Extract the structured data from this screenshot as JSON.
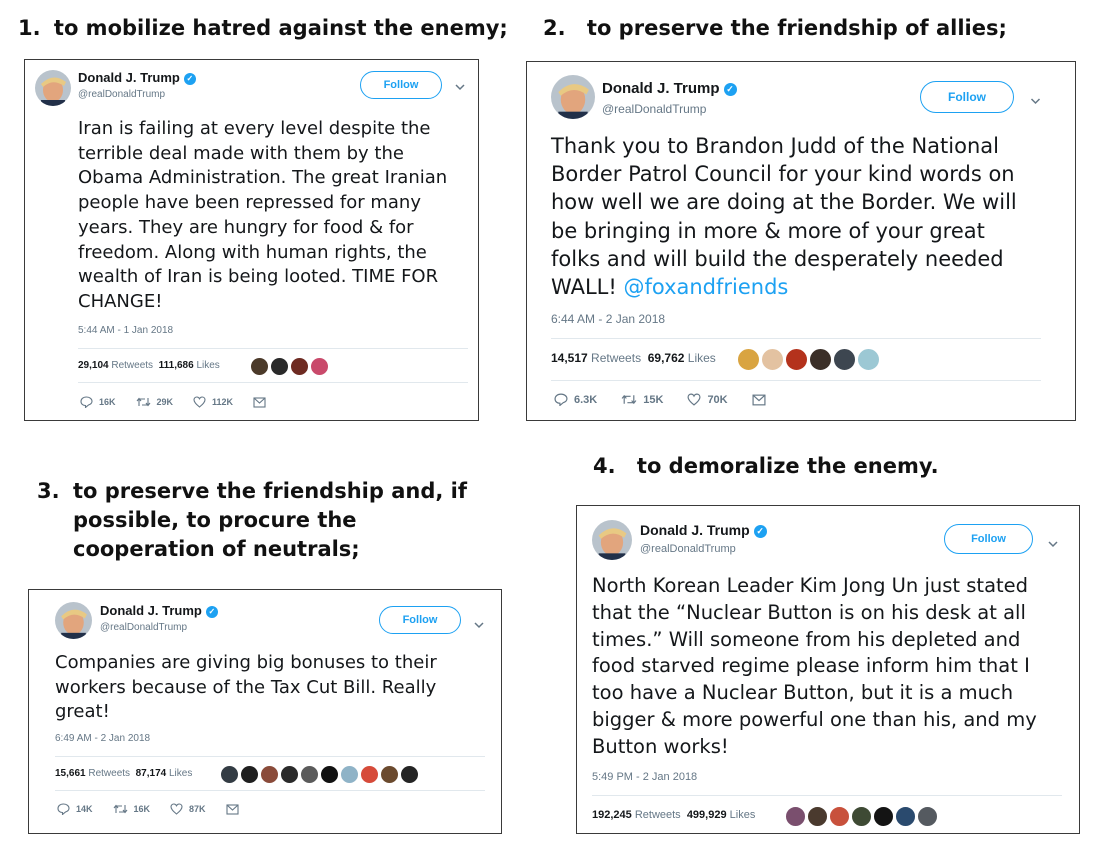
{
  "captions": [
    {
      "num": "1.",
      "text": "to mobilize hatred against the enemy;"
    },
    {
      "num": "2.",
      "text": "to preserve the friendship of allies;"
    },
    {
      "num": "3.",
      "text": "to preserve the friendship and, if possible, to procure the cooperation of neutrals;"
    },
    {
      "num": "4.",
      "text": "to demoralize the enemy."
    }
  ],
  "tweets": [
    {
      "name": "Donald J. Trump",
      "handle": "@realDonaldTrump",
      "follow_label": "Follow",
      "text": "Iran is failing at every level despite the\nterrible deal made with them by the\nObama Administration. The great Iranian\npeople have been repressed for many\nyears. They are hungry for food & for\nfreedom. Along with human rights, the\nwealth of Iran is being looted. TIME FOR\nCHANGE!",
      "link": "",
      "time": "5:44 AM - 1 Jan 2018",
      "retweets": "29,104",
      "retweets_label": "Retweets",
      "likes": "111,686",
      "likes_label": "Likes",
      "replies_count": "16K",
      "retweet_count": "29K",
      "like_count": "112K"
    },
    {
      "name": "Donald J. Trump",
      "handle": "@realDonaldTrump",
      "follow_label": "Follow",
      "text": "Thank you to Brandon Judd of the National\nBorder Patrol Council for your kind words on\nhow well we are doing at the Border. We will\nbe bringing in more & more of your great\nfolks and will build the desperately needed\nWALL! ",
      "link": "@foxandfriends",
      "time": "6:44 AM - 2 Jan 2018",
      "retweets": "14,517",
      "retweets_label": "Retweets",
      "likes": "69,762",
      "likes_label": "Likes",
      "replies_count": "6.3K",
      "retweet_count": "15K",
      "like_count": "70K"
    },
    {
      "name": "Donald J. Trump",
      "handle": "@realDonaldTrump",
      "follow_label": "Follow",
      "text": "Companies are giving big bonuses to their\nworkers because of the Tax Cut Bill. Really\ngreat!",
      "link": "",
      "time": "6:49 AM - 2 Jan 2018",
      "retweets": "15,661",
      "retweets_label": "Retweets",
      "likes": "87,174",
      "likes_label": "Likes",
      "replies_count": "14K",
      "retweet_count": "16K",
      "like_count": "87K"
    },
    {
      "name": "Donald J. Trump",
      "handle": "@realDonaldTrump",
      "follow_label": "Follow",
      "text": "North Korean Leader Kim Jong Un just stated\nthat the “Nuclear Button is on his desk at all\ntimes.” Will someone from his depleted and\nfood starved regime please inform him that I\ntoo have a Nuclear Button, but it is a much\nbigger & more powerful one than his, and my\nButton works!",
      "link": "",
      "time": "5:49 PM - 2 Jan 2018",
      "retweets": "192,245",
      "retweets_label": "Retweets",
      "likes": "499,929",
      "likes_label": "Likes",
      "replies_count": "",
      "retweet_count": "",
      "like_count": ""
    }
  ],
  "colors": {
    "accent": "#1da1f2",
    "muted": "#657786",
    "text": "#14171a"
  },
  "icons": {
    "verified": "verified-badge-icon",
    "chevron": "chevron-down-icon",
    "reply": "reply-icon",
    "retweet": "retweet-icon",
    "like": "heart-icon",
    "dm": "envelope-icon"
  }
}
